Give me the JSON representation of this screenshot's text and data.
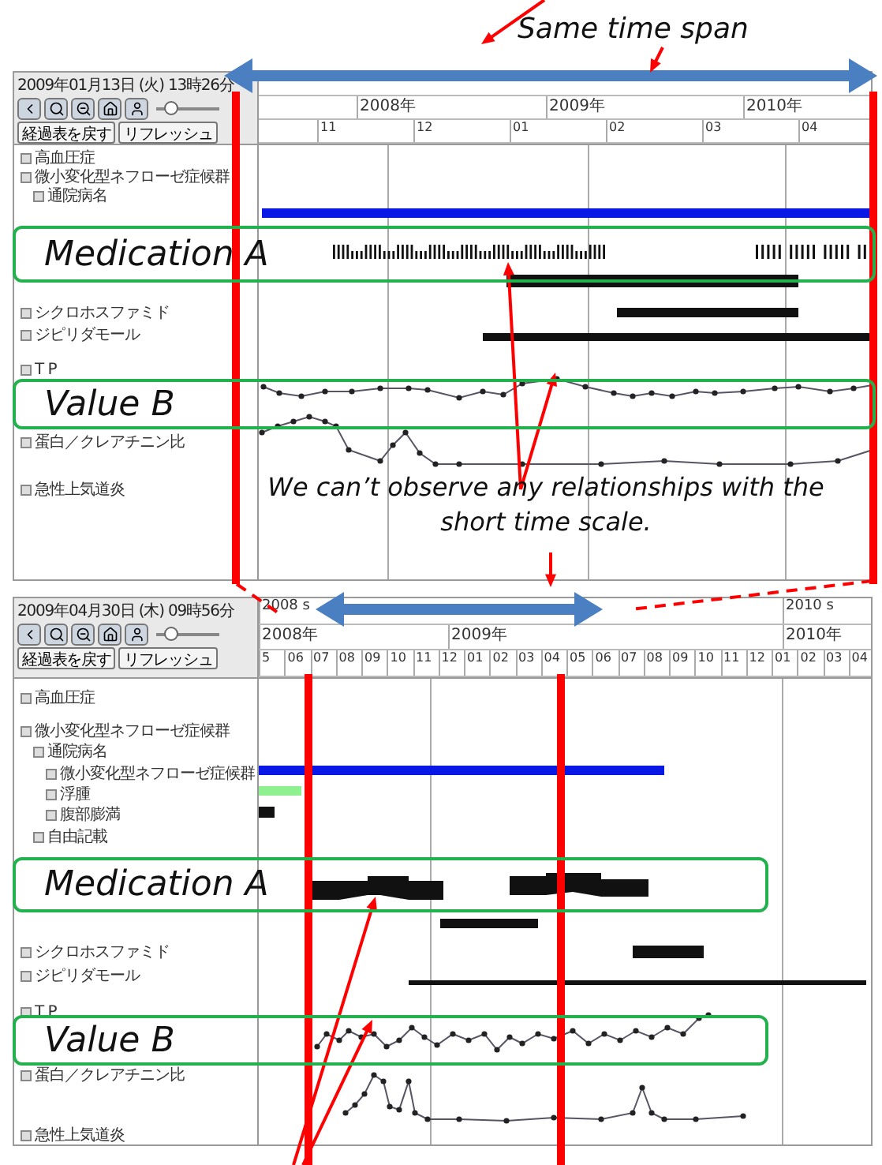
{
  "top_label": "Same time span",
  "panels": [
    {
      "kind": "short_span",
      "timestamp": "2009年01月13日 (火) 13時26分",
      "buttons": [
        "経過表を戻す",
        "リフレッシュ"
      ],
      "slider": {
        "level": 0.25
      },
      "year_row": [
        "2008年",
        "2009年",
        "2010年"
      ],
      "month_row": [
        "11",
        "12",
        "01",
        "02",
        "03",
        "04"
      ],
      "tree": [
        {
          "label": "高血圧症"
        },
        {
          "label": "微小変化型ネフローゼ症候群",
          "children": [
            {
              "label": "通院病名"
            }
          ]
        },
        {
          "label": "シクロホスファミド"
        },
        {
          "label": "ジピリダモール"
        },
        {
          "label": "T P"
        },
        {
          "label": "蛋白／クレアチニン比"
        },
        {
          "label": "急性上気道炎"
        }
      ]
    },
    {
      "kind": "long_span",
      "timestamp": "2009年04月30日 (木) 09時56分",
      "buttons": [
        "経過表を戻す",
        "リフレッシュ"
      ],
      "slider": {
        "level": 0.25
      },
      "top_row": [
        "2008 s",
        "2010 s"
      ],
      "year_row": [
        "2008年",
        "2009年",
        "2010年"
      ],
      "month_row": [
        "5",
        "06",
        "07",
        "08",
        "09",
        "10",
        "11",
        "12",
        "01",
        "02",
        "03",
        "04",
        "05",
        "06",
        "07",
        "08",
        "09",
        "10",
        "11",
        "12",
        "01",
        "02",
        "03",
        "04"
      ],
      "tree": [
        {
          "label": "高血圧症"
        },
        {
          "label": "微小変化型ネフローゼ症候群",
          "children": [
            {
              "label": "通院病名",
              "children": [
                {
                  "label": "微小変化型ネフローゼ症候群"
                },
                {
                  "label": "浮腫"
                },
                {
                  "label": "腹部膨満"
                }
              ]
            },
            {
              "label": "自由記載"
            }
          ]
        },
        {
          "label": "シクロホスファミド"
        },
        {
          "label": "ジピリダモール"
        },
        {
          "label": "T P"
        },
        {
          "label": "蛋白／クレアチニン比"
        },
        {
          "label": "急性上気道炎"
        }
      ]
    }
  ],
  "highlights": [
    "Medication A",
    "Value B",
    "Medication A",
    "Value B"
  ],
  "caption": "We can’t observe any relationships with the short time scale."
}
